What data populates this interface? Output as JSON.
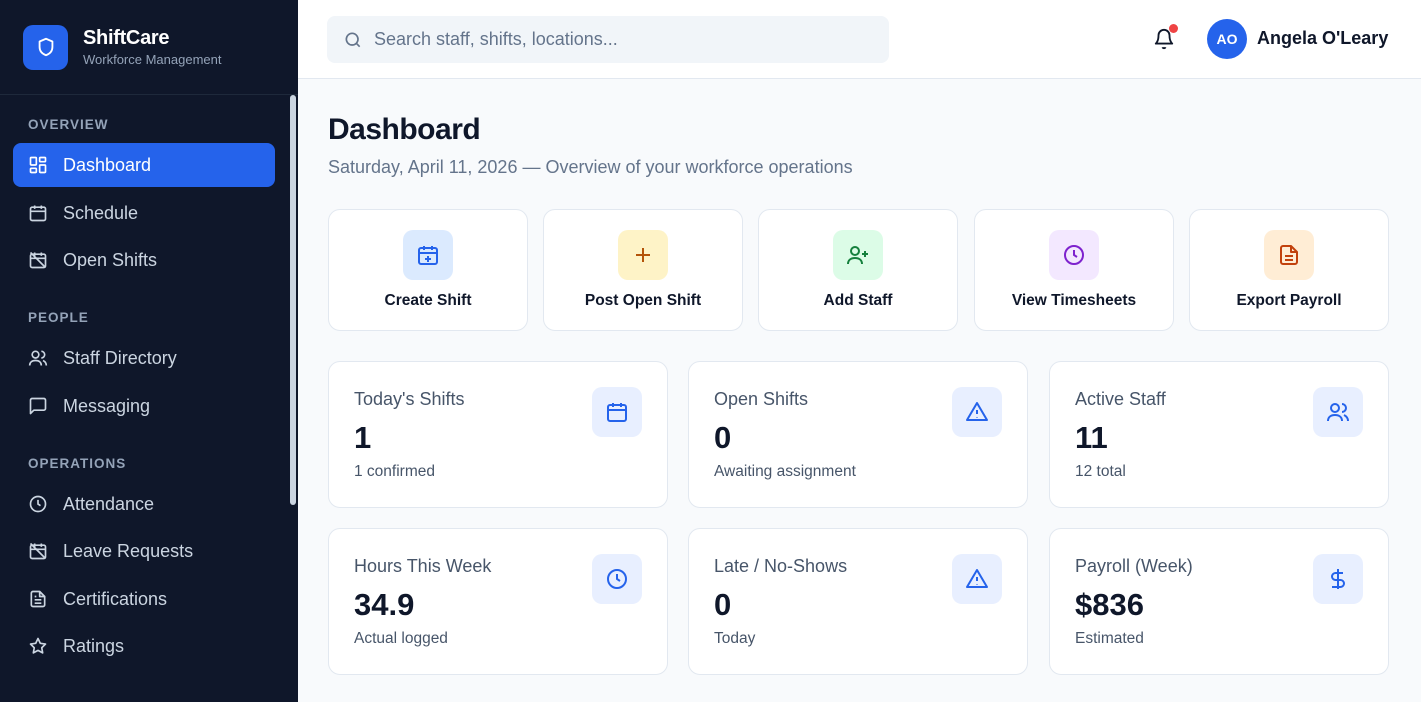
{
  "brand": {
    "name": "ShiftCare",
    "subtitle": "Workforce Management"
  },
  "sidebar": {
    "sections": [
      {
        "label": "OVERVIEW"
      },
      {
        "label": "PEOPLE"
      },
      {
        "label": "OPERATIONS"
      }
    ],
    "items": [
      {
        "label": "Dashboard",
        "icon": "dashboard-grid-icon",
        "active": true
      },
      {
        "label": "Schedule",
        "icon": "calendar-icon"
      },
      {
        "label": "Open Shifts",
        "icon": "calendar-off-icon"
      },
      {
        "label": "Staff Directory",
        "icon": "users-icon"
      },
      {
        "label": "Messaging",
        "icon": "message-square-icon"
      },
      {
        "label": "Attendance",
        "icon": "clock-icon"
      },
      {
        "label": "Leave Requests",
        "icon": "calendar-off-icon"
      },
      {
        "label": "Certifications",
        "icon": "document-icon"
      },
      {
        "label": "Ratings",
        "icon": "star-icon"
      }
    ]
  },
  "header": {
    "search_placeholder": "Search staff, shifts, locations...",
    "user_initials": "AO",
    "user_name": "Angela O'Leary",
    "has_notifications": true
  },
  "page": {
    "title": "Dashboard",
    "subtitle": "Saturday, April 11, 2026 — Overview of your workforce operations"
  },
  "quick_actions": [
    {
      "label": "Create Shift",
      "icon": "calendar-plus-icon",
      "bg": "#dbeafe",
      "color": "#2563eb"
    },
    {
      "label": "Post Open Shift",
      "icon": "plus-icon",
      "bg": "#fef3c7",
      "color": "#b45309"
    },
    {
      "label": "Add Staff",
      "icon": "user-plus-icon",
      "bg": "#dcfce7",
      "color": "#15803d"
    },
    {
      "label": "View Timesheets",
      "icon": "clock-icon",
      "bg": "#f3e8ff",
      "color": "#7e22ce"
    },
    {
      "label": "Export Payroll",
      "icon": "file-text-icon",
      "bg": "#ffedd5",
      "color": "#c2410c"
    }
  ],
  "stats": [
    {
      "label": "Today's Shifts",
      "value": "1",
      "note": "1 confirmed",
      "icon": "calendar-icon"
    },
    {
      "label": "Open Shifts",
      "value": "0",
      "note": "Awaiting assignment",
      "icon": "alert-triangle-icon"
    },
    {
      "label": "Active Staff",
      "value": "11",
      "note": "12 total",
      "icon": "users-icon"
    },
    {
      "label": "Hours This Week",
      "value": "34.9",
      "note": "Actual logged",
      "icon": "clock-icon"
    },
    {
      "label": "Late / No-Shows",
      "value": "0",
      "note": "Today",
      "icon": "alert-triangle-icon"
    },
    {
      "label": "Payroll (Week)",
      "value": "$836",
      "note": "Estimated",
      "icon": "dollar-icon"
    }
  ],
  "colors": {
    "sidebar_bg": "#0f172a",
    "accent": "#2563eb",
    "notification_dot": "#ef4444"
  }
}
